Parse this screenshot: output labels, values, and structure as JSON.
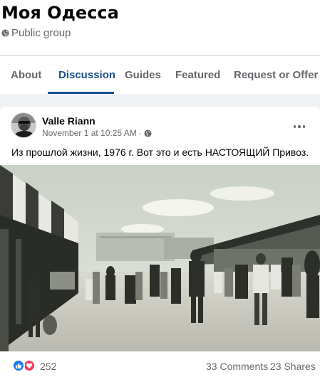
{
  "group": {
    "name": "Моя Одесса",
    "privacy_label": "Public group",
    "privacy_icon": "globe-icon"
  },
  "tabs": [
    {
      "label": "About",
      "active": false
    },
    {
      "label": "Discussion",
      "active": true
    },
    {
      "label": "Guides",
      "active": false
    },
    {
      "label": "Featured",
      "active": false
    },
    {
      "label": "Request or Offer Help",
      "active": false
    }
  ],
  "post": {
    "author": "Valle Riann",
    "timestamp": "November 1 at 10:25 AM",
    "separator": "·",
    "audience_icon": "globe-icon",
    "menu_icon": "more-options-icon",
    "text": "Из прошлой жизни, 1976 г. Вот это и есть НАСТОЯЩИЙ Привоз.",
    "photo_icon": "market-photo",
    "reactions": {
      "icons": [
        "like-icon",
        "love-icon"
      ],
      "count": "252",
      "comments": "33 Comments",
      "shares": "23 Shares"
    }
  },
  "colors": {
    "accent": "#1b4f8f",
    "secondary_text": "#65676b",
    "like": "#1877f2",
    "love": "#f33e58"
  }
}
